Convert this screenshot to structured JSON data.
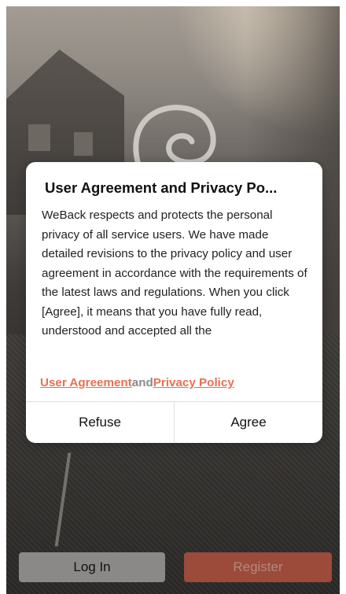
{
  "dialog": {
    "title": "User Agreement and Privacy Po...",
    "body": "WeBack respects and protects the personal privacy of all service users. We have made detailed revisions to the privacy policy and user agreement in accordance with the requirements of the latest laws and regulations. When you click [Agree], it means that you have fully read, understood and accepted all the",
    "user_agreement_link": "User Agreement",
    "and_text": "and",
    "privacy_policy_link": "Privacy Policy",
    "refuse_label": "Refuse",
    "agree_label": "Agree"
  },
  "bottom": {
    "login_label": "Log In",
    "register_label": "Register"
  },
  "colors": {
    "link": "#ea6e51",
    "register_button": "#9c4a3a",
    "login_button": "#8a8987"
  },
  "icons": {
    "app_logo": "weback-logo-icon"
  }
}
